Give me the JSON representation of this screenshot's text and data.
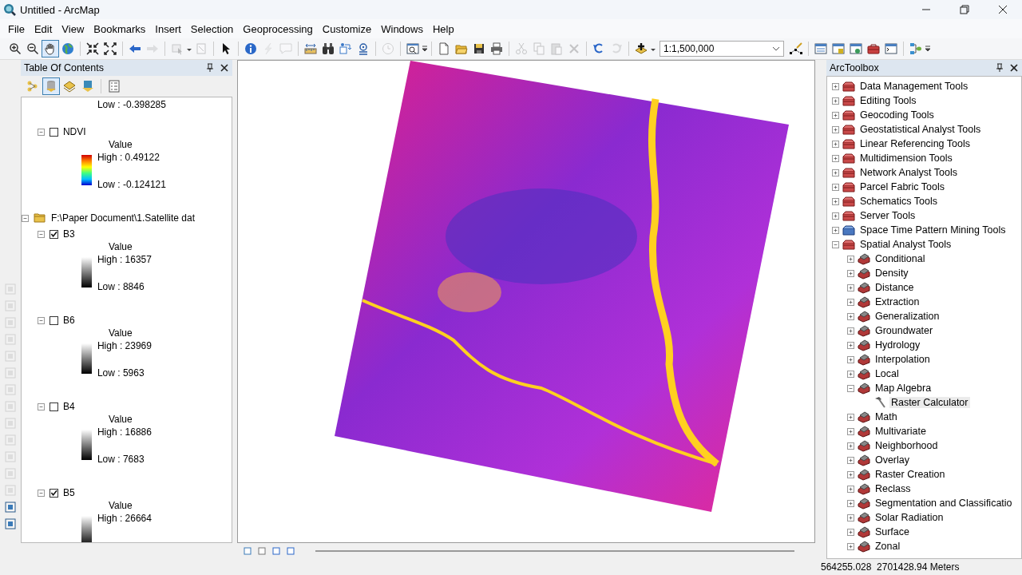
{
  "window": {
    "title": "Untitled - ArcMap"
  },
  "menu": [
    "File",
    "Edit",
    "View",
    "Bookmarks",
    "Insert",
    "Selection",
    "Geoprocessing",
    "Customize",
    "Windows",
    "Help"
  ],
  "toolbar": [
    {
      "selected": false,
      "disabled": false
    },
    {
      "selected": false,
      "disabled": false
    },
    {
      "selected": true,
      "disabled": false
    },
    {
      "selected": false,
      "disabled": false
    },
    {
      "selected": false,
      "disabled": false
    },
    {
      "selected": false,
      "disabled": false
    },
    {
      "selected": false,
      "disabled": false
    },
    {
      "selected": false,
      "disabled": true
    },
    {
      "selected": false,
      "disabled": true
    },
    {
      "selected": false,
      "disabled": true
    },
    {
      "selected": false,
      "disabled": false
    },
    {
      "selected": false,
      "disabled": false
    },
    {
      "selected": false,
      "disabled": true
    },
    {
      "selected": false,
      "disabled": true
    },
    {
      "selected": false,
      "disabled": false
    },
    {
      "selected": false,
      "disabled": false
    },
    {
      "selected": false,
      "disabled": false
    },
    {
      "selected": false,
      "disabled": false
    },
    {
      "selected": false,
      "disabled": true
    },
    {
      "selected": false,
      "disabled": false
    }
  ],
  "toolbar2": [
    {
      "selected": false,
      "disabled": false
    },
    {
      "selected": false,
      "disabled": false
    },
    {
      "selected": false,
      "disabled": false
    },
    {
      "selected": false,
      "disabled": false
    },
    {
      "selected": false,
      "disabled": true
    },
    {
      "selected": false,
      "disabled": true
    },
    {
      "selected": false,
      "disabled": true
    },
    {
      "selected": false,
      "disabled": true
    },
    {
      "selected": false,
      "disabled": false
    },
    {
      "selected": false,
      "disabled": true
    },
    {
      "selected": false,
      "disabled": false
    }
  ],
  "scale_field": {
    "value": "1:1,500,000"
  },
  "toolbar3": [
    {
      "selected": false,
      "disabled": false
    },
    {
      "selected": false,
      "disabled": false
    },
    {
      "selected": false,
      "disabled": false
    },
    {
      "selected": false,
      "disabled": false
    },
    {
      "selected": false,
      "disabled": false
    },
    {
      "selected": false,
      "disabled": false
    },
    {
      "selected": false,
      "disabled": false
    }
  ],
  "layout_toolbar": [
    {
      "disabled": true
    },
    {
      "disabled": true
    },
    {
      "disabled": true
    },
    {
      "disabled": true
    },
    {
      "disabled": true
    },
    {
      "disabled": true
    },
    {
      "disabled": true
    },
    {
      "disabled": true
    },
    {
      "disabled": true
    },
    {
      "disabled": true
    },
    {
      "disabled": true
    },
    {
      "disabled": true
    },
    {
      "disabled": true
    },
    {
      "disabled": false
    },
    {
      "disabled": false
    }
  ],
  "toc": {
    "title": "Table Of Contents",
    "tabs": [
      {
        "selected": false
      },
      {
        "selected": true
      },
      {
        "selected": false
      },
      {
        "selected": false
      },
      {
        "selected": false
      }
    ],
    "items": [
      {
        "kind": "legend_tail",
        "low": "Low : -0.398285"
      },
      {
        "kind": "layer",
        "name": "NDVI",
        "checked": false,
        "expanded": true,
        "legend": {
          "kind": "color_ramp",
          "field": "Value",
          "high": "High : 0.49122",
          "low": "Low : -0.124121"
        }
      },
      {
        "kind": "group",
        "name": "F:\\Paper Document\\1.Satellite dat",
        "expanded": true,
        "children": [
          {
            "kind": "layer",
            "name": "B3",
            "checked": true,
            "expanded": true,
            "legend": {
              "kind": "gray_ramp",
              "field": "Value",
              "high": "High : 16357",
              "low": "Low : 8846"
            }
          },
          {
            "kind": "layer",
            "name": "B6",
            "checked": false,
            "expanded": true,
            "legend": {
              "kind": "gray_ramp",
              "field": "Value",
              "high": "High : 23969",
              "low": "Low : 5963"
            }
          },
          {
            "kind": "layer",
            "name": "B4",
            "checked": false,
            "expanded": true,
            "legend": {
              "kind": "gray_ramp",
              "field": "Value",
              "high": "High : 16886",
              "low": "Low : 7683"
            }
          },
          {
            "kind": "layer",
            "name": "B5",
            "checked": true,
            "expanded": true,
            "legend": {
              "kind": "gray_ramp",
              "field": "Value",
              "high": "High : 26664"
            }
          }
        ]
      }
    ]
  },
  "toolbox": {
    "title": "ArcToolbox",
    "items": [
      {
        "kind": "toolbox",
        "name": "Data Management Tools",
        "expanded": false
      },
      {
        "kind": "toolbox",
        "name": "Editing Tools",
        "expanded": false
      },
      {
        "kind": "toolbox",
        "name": "Geocoding Tools",
        "expanded": false
      },
      {
        "kind": "toolbox",
        "name": "Geostatistical Analyst Tools",
        "expanded": false
      },
      {
        "kind": "toolbox",
        "name": "Linear Referencing Tools",
        "expanded": false
      },
      {
        "kind": "toolbox",
        "name": "Multidimension Tools",
        "expanded": false
      },
      {
        "kind": "toolbox",
        "name": "Network Analyst Tools",
        "expanded": false
      },
      {
        "kind": "toolbox",
        "name": "Parcel Fabric Tools",
        "expanded": false
      },
      {
        "kind": "toolbox",
        "name": "Schematics Tools",
        "expanded": false
      },
      {
        "kind": "toolbox",
        "name": "Server Tools",
        "expanded": false
      },
      {
        "kind": "script_toolbox",
        "name": "Space Time Pattern Mining Tools",
        "expanded": false
      },
      {
        "kind": "toolbox",
        "name": "Spatial Analyst Tools",
        "expanded": true,
        "children": [
          {
            "kind": "toolset",
            "name": "Conditional",
            "expanded": false
          },
          {
            "kind": "toolset",
            "name": "Density",
            "expanded": false
          },
          {
            "kind": "toolset",
            "name": "Distance",
            "expanded": false
          },
          {
            "kind": "toolset",
            "name": "Extraction",
            "expanded": false
          },
          {
            "kind": "toolset",
            "name": "Generalization",
            "expanded": false
          },
          {
            "kind": "toolset",
            "name": "Groundwater",
            "expanded": false
          },
          {
            "kind": "toolset",
            "name": "Hydrology",
            "expanded": false
          },
          {
            "kind": "toolset",
            "name": "Interpolation",
            "expanded": false
          },
          {
            "kind": "toolset",
            "name": "Local",
            "expanded": false
          },
          {
            "kind": "toolset",
            "name": "Map Algebra",
            "expanded": true,
            "children": [
              {
                "kind": "tool",
                "name": "Raster Calculator",
                "selected": true
              }
            ]
          },
          {
            "kind": "toolset",
            "name": "Math",
            "expanded": false
          },
          {
            "kind": "toolset",
            "name": "Multivariate",
            "expanded": false
          },
          {
            "kind": "toolset",
            "name": "Neighborhood",
            "expanded": false
          },
          {
            "kind": "toolset",
            "name": "Overlay",
            "expanded": false
          },
          {
            "kind": "toolset",
            "name": "Raster Creation",
            "expanded": false
          },
          {
            "kind": "toolset",
            "name": "Reclass",
            "expanded": false
          },
          {
            "kind": "toolset",
            "name": "Segmentation and Classificatio",
            "expanded": false
          },
          {
            "kind": "toolset",
            "name": "Solar Radiation",
            "expanded": false
          },
          {
            "kind": "toolset",
            "name": "Surface",
            "expanded": false
          },
          {
            "kind": "toolset",
            "name": "Zonal",
            "expanded": false
          }
        ]
      }
    ]
  },
  "status_bar": {
    "coordinates": "564255.028  2701428.94 Meters"
  }
}
